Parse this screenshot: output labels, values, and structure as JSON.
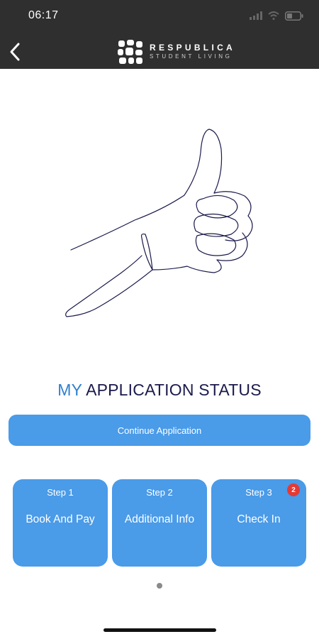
{
  "status_bar": {
    "time": "06:17",
    "icons": [
      "cellular-signal-icon",
      "wifi-icon",
      "battery-icon"
    ]
  },
  "header": {
    "back_icon": "chevron-left-icon",
    "logo": {
      "title": "RESPUBLICA",
      "subtitle": "STUDENT LIVING"
    }
  },
  "illustration": {
    "icon": "thumbs-up-icon"
  },
  "heading": {
    "prefix": "MY",
    "text": "APPLICATION STATUS"
  },
  "continue_button": {
    "label": "Continue Application"
  },
  "steps": [
    {
      "number": "Step 1",
      "label": "Book And Pay",
      "badge": null
    },
    {
      "number": "Step 2",
      "label": "Additional Info",
      "badge": null
    },
    {
      "number": "Step 3",
      "label": "Check In",
      "badge": "2"
    }
  ],
  "colors": {
    "header_bg": "#2f2f2f",
    "accent_button": "#4a9be8",
    "heading_dark": "#1b1a4c",
    "heading_accent": "#2f80d1",
    "badge": "#e53935"
  }
}
